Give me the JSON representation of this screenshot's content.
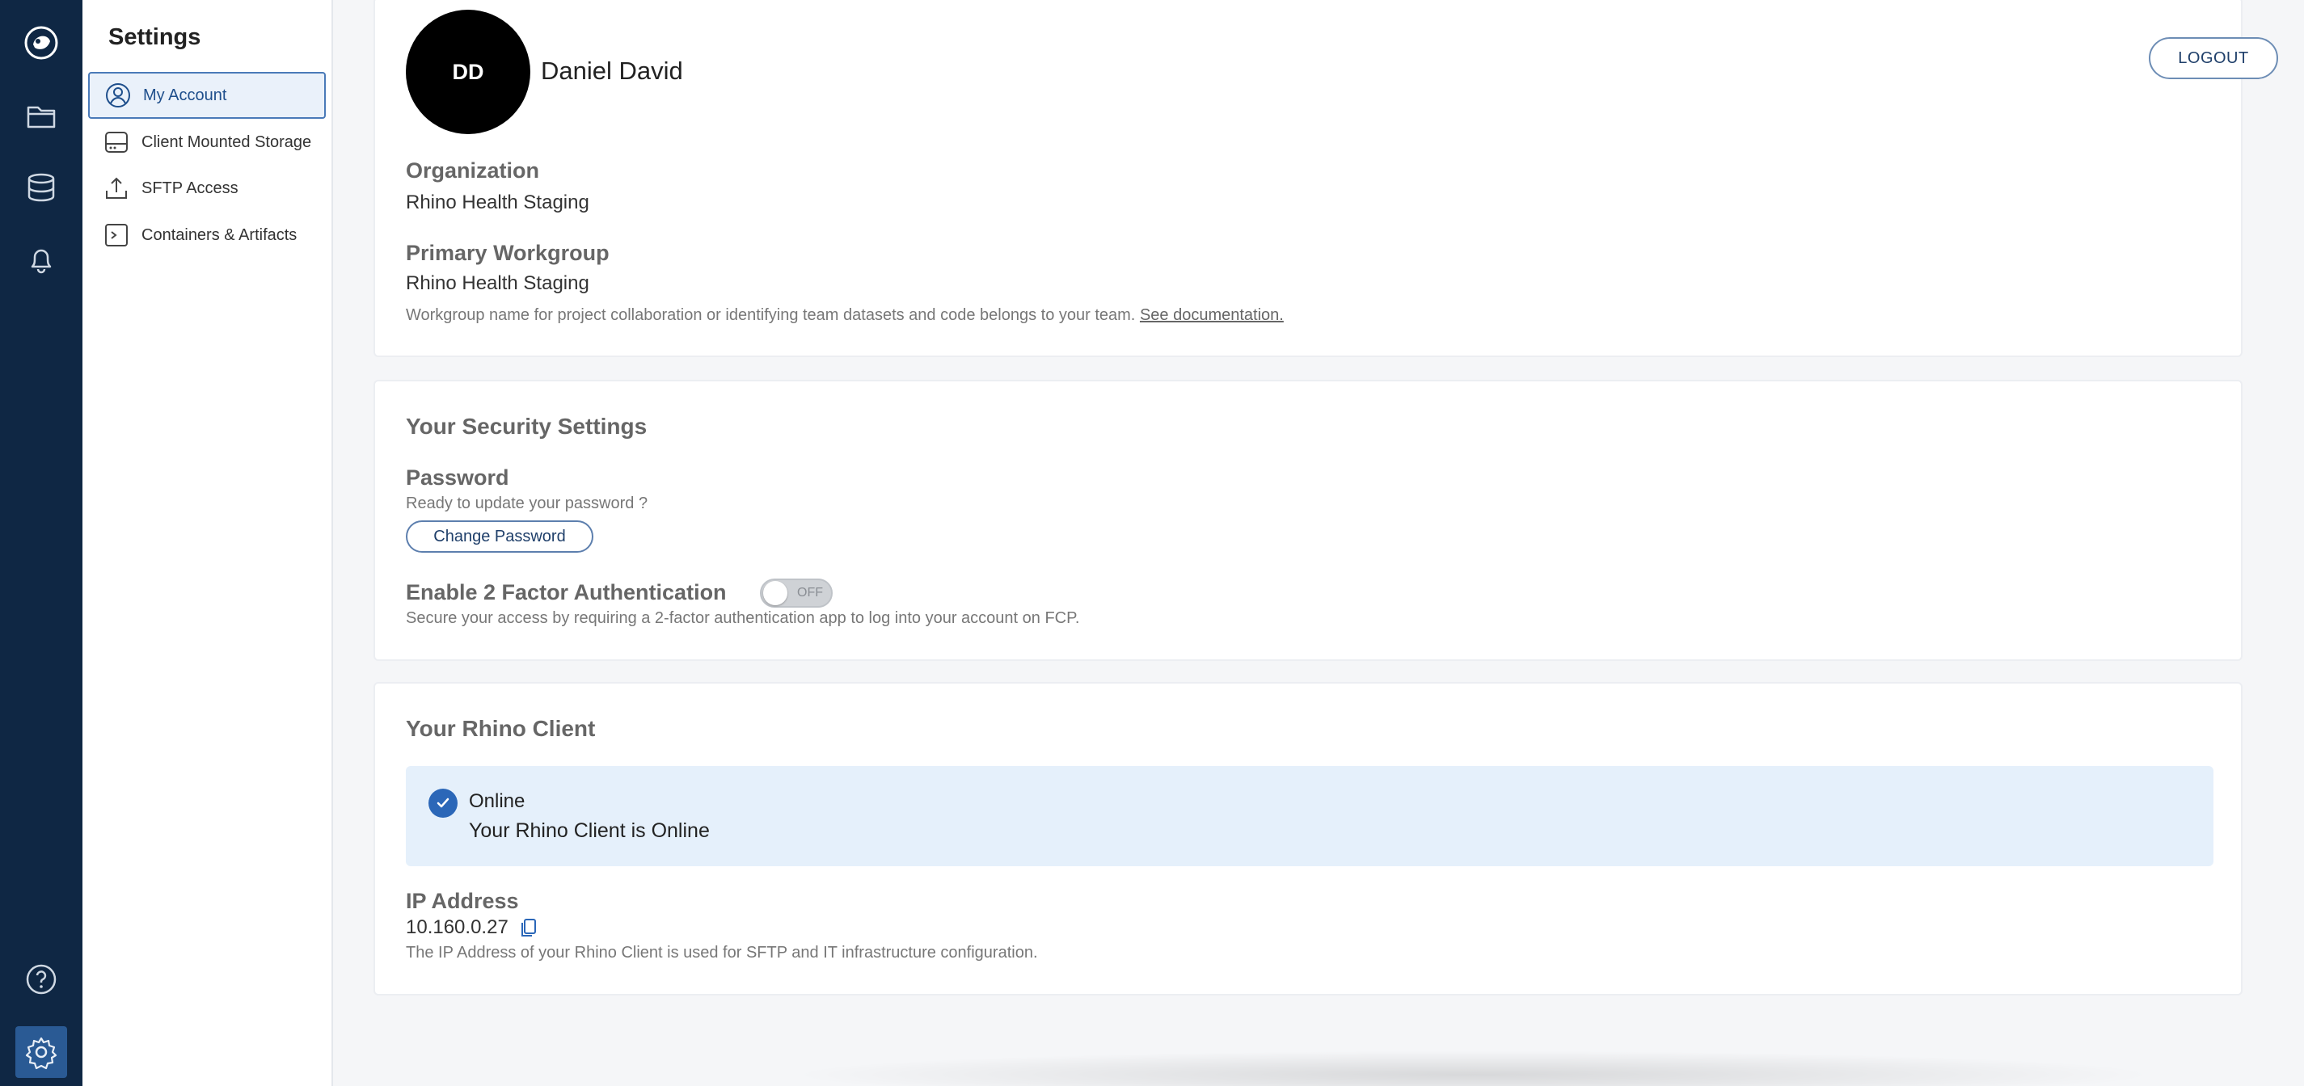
{
  "rail": {
    "items": [
      {
        "icon": "logo-icon"
      },
      {
        "icon": "folder-icon"
      },
      {
        "icon": "database-icon"
      },
      {
        "icon": "bell-icon"
      },
      {
        "icon": "help-icon"
      },
      {
        "icon": "settings-gear-icon"
      }
    ]
  },
  "sidebar": {
    "title": "Settings",
    "items": [
      {
        "label": "My Account",
        "icon": "user-circle-icon",
        "active": true
      },
      {
        "label": "Client Mounted Storage",
        "icon": "hard-drive-icon",
        "active": false
      },
      {
        "label": "SFTP Access",
        "icon": "upload-icon",
        "active": false
      },
      {
        "label": "Containers & Artifacts",
        "icon": "terminal-icon",
        "active": false
      }
    ]
  },
  "account": {
    "avatar_initials": "DD",
    "user_name": "Daniel David",
    "logout_label": "LOGOUT",
    "organization_label": "Organization",
    "organization_value": "Rhino Health Staging",
    "workgroup_label": "Primary Workgroup",
    "workgroup_value": "Rhino Health Staging",
    "workgroup_hint": "Workgroup name for project collaboration or identifying team datasets and code belongs to your team.",
    "workgroup_link": "See documentation."
  },
  "security": {
    "title": "Your Security Settings",
    "password_label": "Password",
    "password_hint": "Ready to update your password ?",
    "change_password_label": "Change Password",
    "twofa_label": "Enable 2 Factor Authentication",
    "twofa_toggle_text": "OFF",
    "twofa_enabled": false,
    "twofa_hint": "Secure your access by requiring a 2-factor authentication app to log into your account on FCP."
  },
  "client": {
    "title": "Your Rhino Client",
    "status_title": "Online",
    "status_desc": "Your Rhino Client is Online",
    "ip_label": "IP Address",
    "ip_value": "10.160.0.27",
    "ip_hint": "The IP Address of your Rhino Client is used for SFTP and IT infrastructure configuration."
  },
  "colors": {
    "rail_bg": "#0f2744",
    "accent": "#2b67b8",
    "status_bg": "#e5f0fb"
  }
}
